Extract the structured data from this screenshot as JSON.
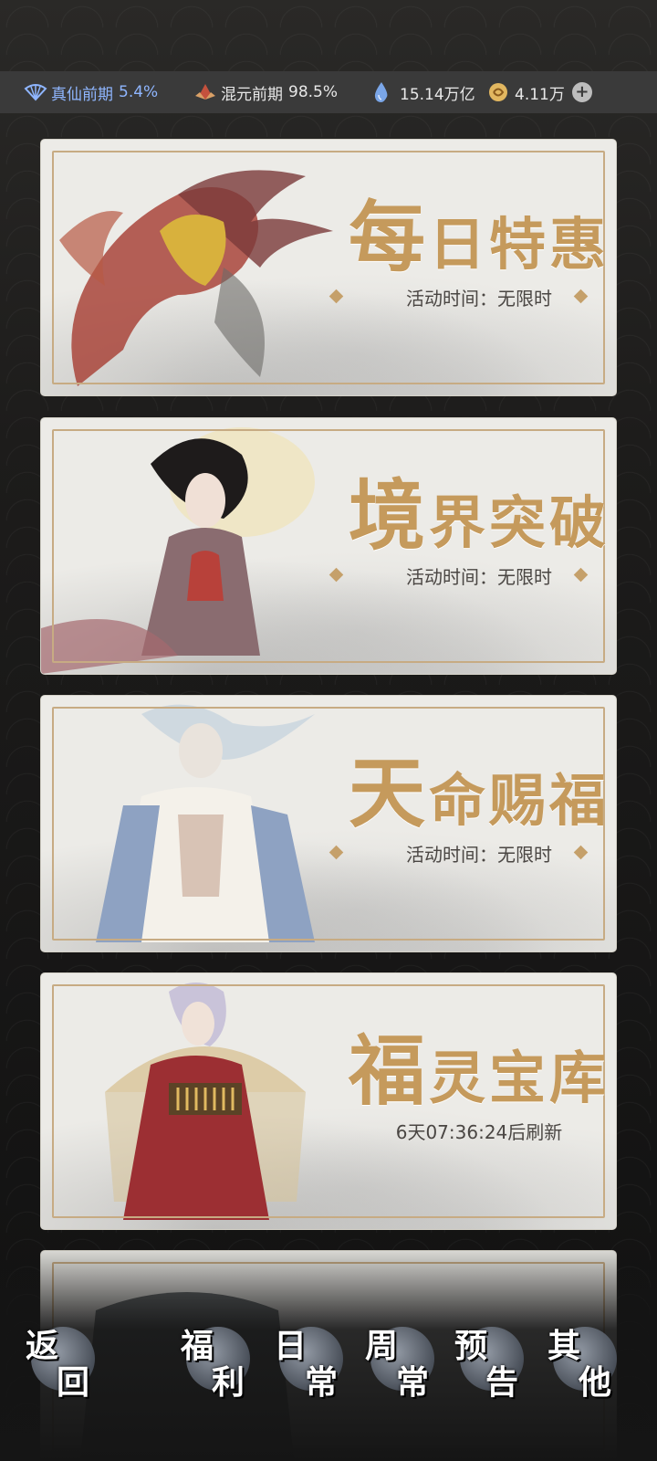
{
  "resources": [
    {
      "icon": "fan-icon",
      "label": "真仙前期",
      "value": "5.4%"
    },
    {
      "icon": "lotus-icon",
      "label": "混元前期",
      "value": "98.5%"
    },
    {
      "icon": "water-drop-icon",
      "label": "",
      "value": "15.14万亿"
    },
    {
      "icon": "coin-icon",
      "label": "",
      "value": "4.11万"
    }
  ],
  "cards": [
    {
      "title_first": "每",
      "title_rest": "日特惠",
      "subtitle": "活动时间：无限时",
      "art": "phoenix"
    },
    {
      "title_first": "境",
      "title_rest": "界突破",
      "subtitle": "活动时间：无限时",
      "art": "immortal-lady"
    },
    {
      "title_first": "天",
      "title_rest": "命赐福",
      "subtitle": "活动时间：无限时",
      "art": "white-sage"
    },
    {
      "title_first": "福",
      "title_rest": "灵宝库",
      "subtitle": "6天07:36:24后刷新",
      "art": "abacus-girl"
    }
  ],
  "nav": [
    {
      "c1": "返",
      "c2": "回"
    },
    {
      "c1": "福",
      "c2": "利"
    },
    {
      "c1": "日",
      "c2": "常"
    },
    {
      "c1": "周",
      "c2": "常"
    },
    {
      "c1": "预",
      "c2": "告"
    },
    {
      "c1": "其",
      "c2": "他"
    }
  ],
  "colors": {
    "accent_gold": "#c59a5c",
    "topbar": "#3a3a3a",
    "percent_blue": "#8fb6ff"
  }
}
